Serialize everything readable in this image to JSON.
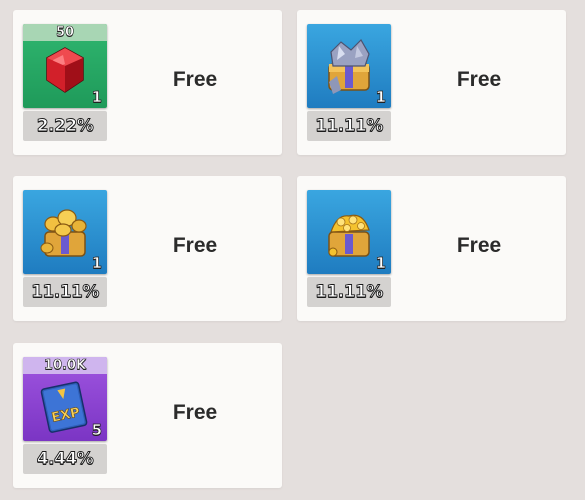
{
  "rewards": [
    {
      "name": "ruby",
      "icon": "red-gem-icon",
      "top_label": "50",
      "count": "1",
      "percent": "2.22%",
      "price": "Free",
      "bg_color": "#2fb66f"
    },
    {
      "name": "iron-chest",
      "icon": "iron-chest-icon",
      "top_label": "",
      "count": "1",
      "percent": "11.11%",
      "price": "Free",
      "bg_color": "#3aa6e0"
    },
    {
      "name": "gold-chest",
      "icon": "gold-chest-icon",
      "top_label": "",
      "count": "1",
      "percent": "11.11%",
      "price": "Free",
      "bg_color": "#3aa6e0"
    },
    {
      "name": "coin-chest",
      "icon": "coin-chest-icon",
      "top_label": "",
      "count": "1",
      "percent": "11.11%",
      "price": "Free",
      "bg_color": "#3aa6e0"
    },
    {
      "name": "exp-book",
      "icon": "exp-book-icon",
      "top_label": "10.0K",
      "count": "5",
      "percent": "4.44%",
      "price": "Free",
      "bg_color": "#9f55e0",
      "icon_text": "EXP"
    }
  ]
}
